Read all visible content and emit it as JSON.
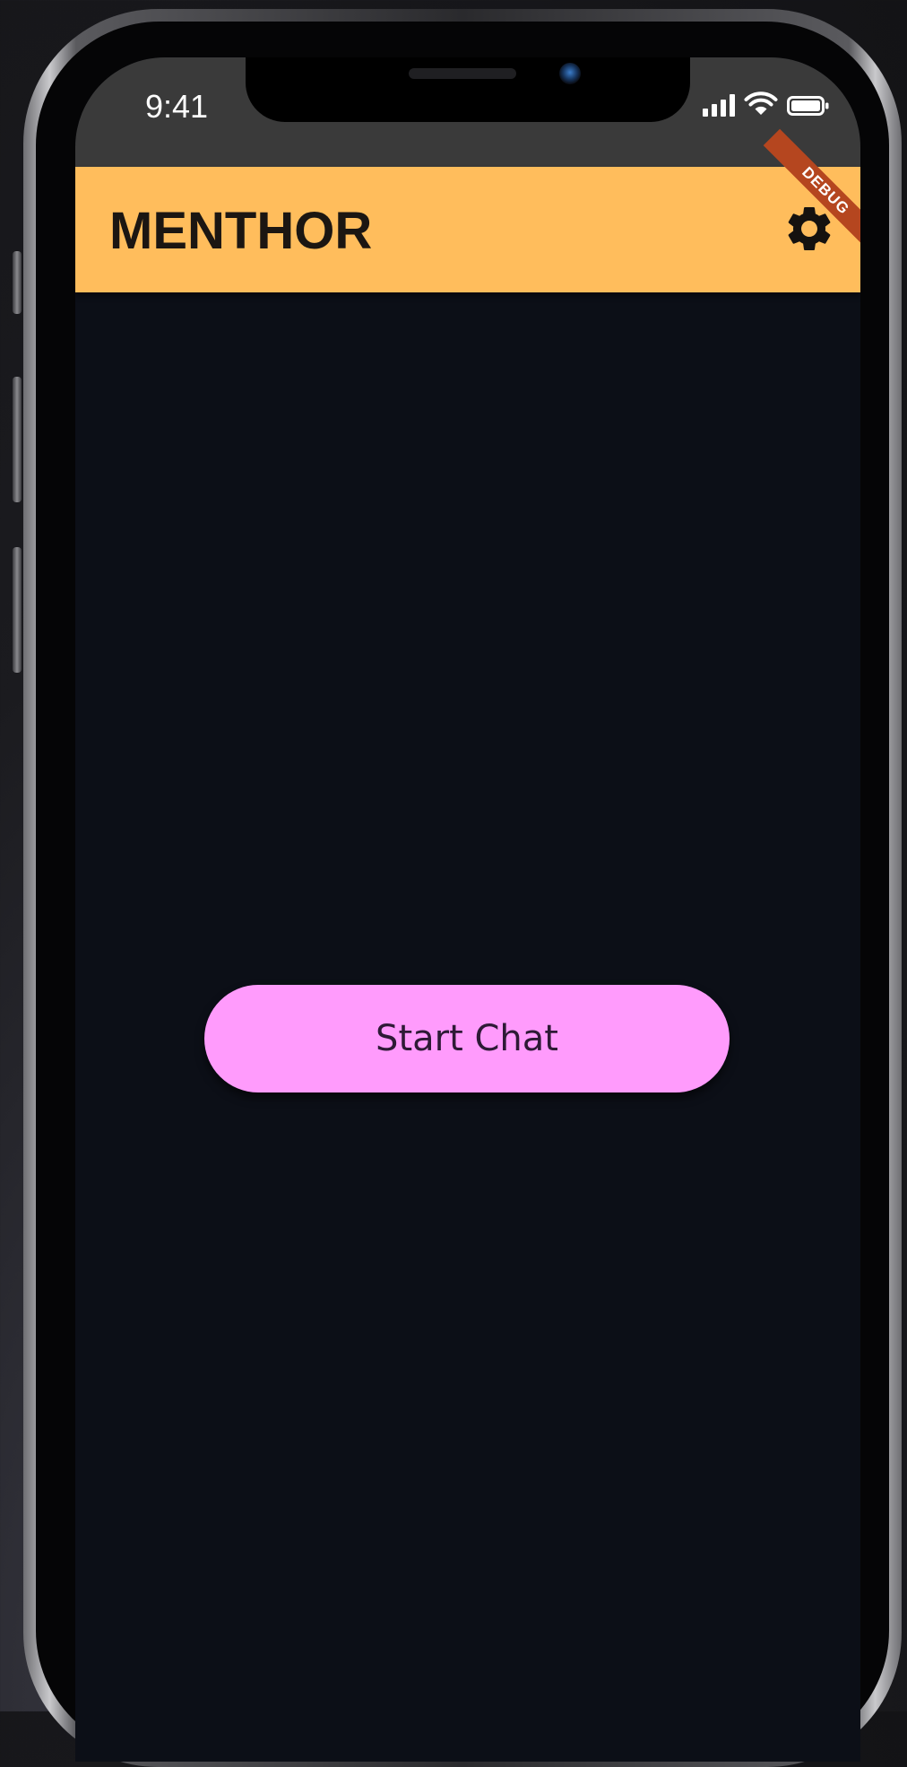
{
  "status_bar": {
    "time": "9:41"
  },
  "app_bar": {
    "title": "MENTHOR",
    "settings_icon": "gear-icon",
    "debug_banner": "DEBUG"
  },
  "main": {
    "start_chat_label": "Start Chat"
  },
  "colors": {
    "app_bar_bg": "#ffbd5c",
    "screen_bg": "#0c0f17",
    "button_bg": "#ff9bfc",
    "status_bar_bg": "#3a3a3a",
    "debug_banner_bg": "#b5461f"
  }
}
